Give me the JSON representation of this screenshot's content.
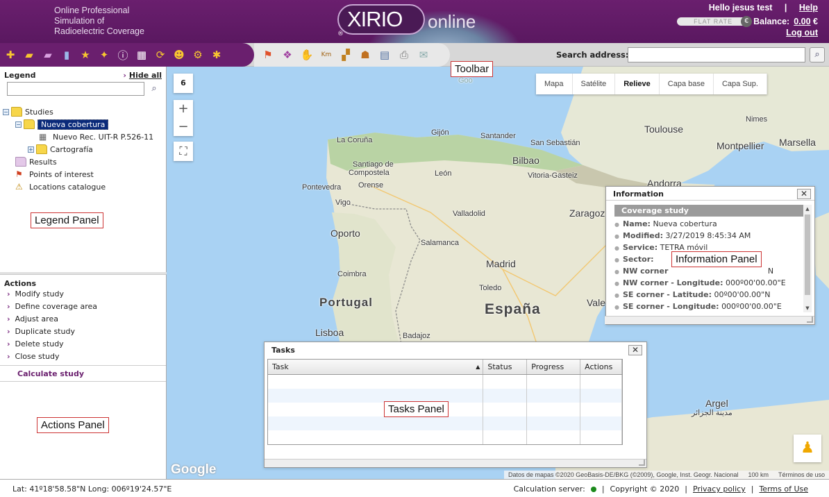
{
  "header": {
    "tagline": [
      "Online Professional",
      "Simulation of",
      "Radioelectric Coverage"
    ],
    "logo_main": "XIRIO",
    "logo_sub": "online",
    "logo_reg": "®",
    "greeting": "Hello jesus test",
    "separator": "|",
    "help": "Help",
    "flat_rate": "FLAT RATE",
    "euro": "€",
    "balance_label": "Balance:",
    "balance_value": "0.00",
    "balance_currency": "€",
    "logout": "Log out"
  },
  "toolbar": {
    "left_icons": [
      "new-folder-icon",
      "open-folder-icon",
      "folder-icon",
      "book-icon",
      "star-folder-icon",
      "star-add-icon",
      "info-icon",
      "table-icon",
      "refresh-icon",
      "user-icon",
      "users-icon",
      "user-settings-icon"
    ],
    "right_icons": [
      "flag-icon",
      "layers-icon",
      "hand-icon",
      "measure-icon",
      "area-icon",
      "population-icon",
      "table-view-icon",
      "print-icon",
      "email-icon"
    ],
    "km_label": "Km",
    "search_label": "Search address:",
    "search_value": ""
  },
  "legend": {
    "title": "Legend",
    "hide_all": "Hide all",
    "tree": {
      "studies": "Studies",
      "selected_study": "Nueva cobertura",
      "model": "Nuevo Rec. UIT-R P.526-11",
      "cartography": "Cartografía",
      "results": "Results",
      "points": "Points of interest",
      "locations": "Locations catalogue"
    }
  },
  "actions": {
    "title": "Actions",
    "items": [
      "Modify study",
      "Define coverage area",
      "Adjust area",
      "Duplicate study",
      "Delete study",
      "Close study"
    ],
    "calculate": "Calculate study"
  },
  "map": {
    "zoom_level": "6",
    "zoom_in": "+",
    "zoom_out": "−",
    "types": [
      "Mapa",
      "Satélite",
      "Relieve",
      "Capa base",
      "Capa Sup."
    ],
    "active_type": "Relieve",
    "labels": {
      "toulouse": "Toulouse",
      "nimes": "Nimes",
      "montpellier": "Montpellier",
      "marsella": "Marsella",
      "andorra": "Andorra",
      "gijon": "Gijón",
      "santander": "Santander",
      "coruna": "La Coruña",
      "sansebastian": "San Sebastián",
      "bilbao": "Bilbao",
      "santiago1": "Santiago de",
      "santiago2": "Compostela",
      "leon": "León",
      "vitoria": "Vitoria-Gasteiz",
      "pontevedra": "Pontevedra",
      "orense": "Orense",
      "vigo": "Vigo",
      "valladolid": "Valladolid",
      "zaragoza": "Zaragoza",
      "oporto": "Oporto",
      "salamanca": "Salamanca",
      "madrid": "Madrid",
      "coimbra": "Coimbra",
      "toledo": "Toledo",
      "portugal": "Portugal",
      "espana": "España",
      "vale": "Vale",
      "lisboa": "Lisboa",
      "badajoz": "Badajoz",
      "argel": "Argel",
      "argel_ar": "مدينة الجزائر",
      "google_watermark": "Goo"
    },
    "google": "Google",
    "attribution": "Datos de mapas ©2020 GeoBasis-DE/BKG (©2009), Google, Inst. Geogr. Nacional",
    "scale": "100 km",
    "terms": "Términos de uso"
  },
  "annotations": {
    "toolbar": "Toolbar",
    "legend": "Legend Panel",
    "actions": "Actions Panel",
    "information": "Information Panel",
    "tasks": "Tasks Panel"
  },
  "info": {
    "title": "Information",
    "section": "Coverage study",
    "rows": [
      {
        "label": "Name:",
        "value": "Nueva cobertura"
      },
      {
        "label": "Modified:",
        "value": "3/27/2019 8:45:34 AM"
      },
      {
        "label": "Service:",
        "value": "TETRA móvil"
      },
      {
        "label": "Sector:",
        "value": ""
      },
      {
        "label": "NW corner",
        "value": "N"
      },
      {
        "label": "NW corner - Longitude:",
        "value": "000º00'00.00\"E"
      },
      {
        "label": "SE corner - Latitude:",
        "value": "00º00'00.00\"N"
      },
      {
        "label": "SE corner - Longitude:",
        "value": "000º00'00.00\"E"
      }
    ],
    "close": "✕"
  },
  "tasks": {
    "title": "Tasks",
    "columns": [
      "Task",
      "Status",
      "Progress",
      "Actions"
    ],
    "rows": 5,
    "close": "✕"
  },
  "status": {
    "coords": "Lat: 41º18'58.58\"N Long: 006º19'24.57\"E",
    "server_label": "Calculation server:",
    "copyright": "Copyright © 2020",
    "privacy": "Privacy policy",
    "terms": "Terms of Use",
    "sep": "|"
  }
}
